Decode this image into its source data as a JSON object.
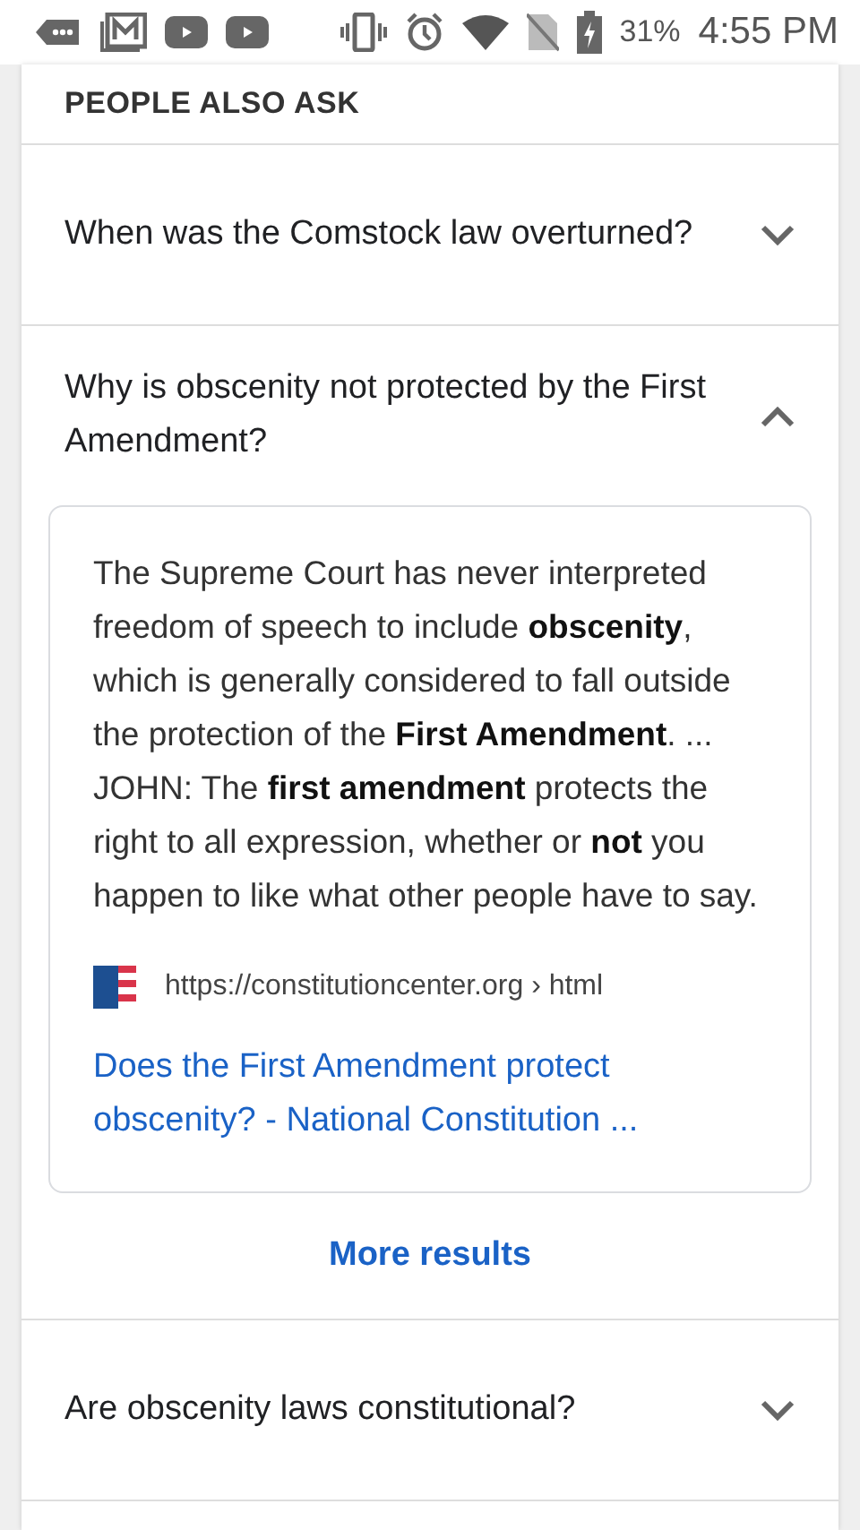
{
  "status_bar": {
    "battery": "31%",
    "time": "4:55 PM"
  },
  "section": {
    "title": "PEOPLE ALSO ASK"
  },
  "questions": [
    {
      "question": "When was the Comstock law overturned?",
      "expanded": false
    },
    {
      "question": "Why is obscenity not protected by the First Amendment?",
      "expanded": true,
      "answer": {
        "text": "The Supreme Court has never interpreted freedom of speech to include **obscenity**, which is generally considered to fall outside the protection of the **First Amendment**. ... JOHN: The **first amendment** protects the right to all expression, whether or **not** you happen to like what other people have to say.",
        "source_url": "https://constitutioncenter.org › html",
        "link": "Does the First Amendment protect obscenity? - National Constitution ..."
      },
      "more": "More results"
    },
    {
      "question": "Are obscenity laws constitutional?",
      "expanded": false
    }
  ]
}
